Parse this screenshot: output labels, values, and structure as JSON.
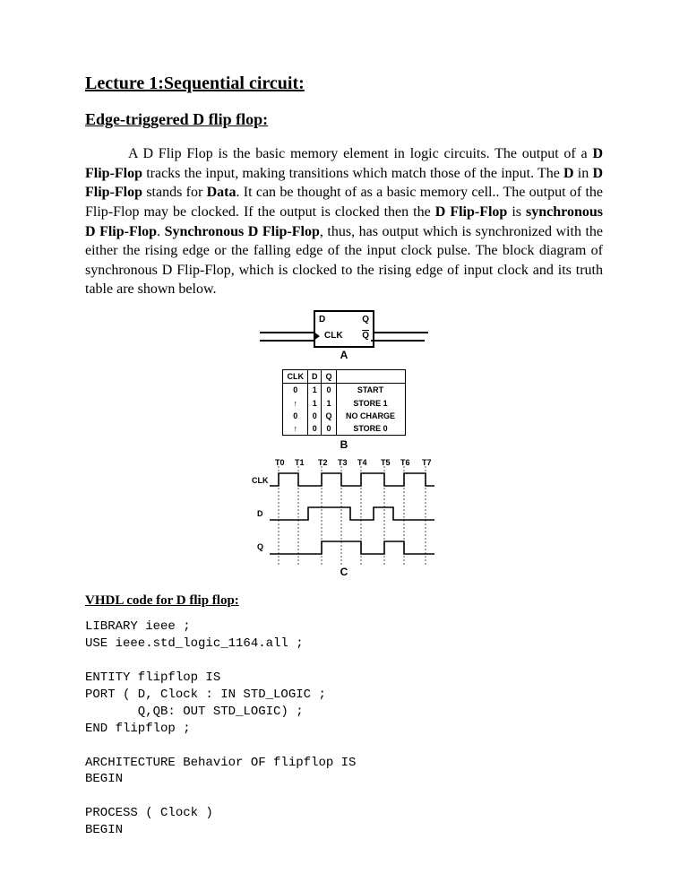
{
  "headings": {
    "lecture": "Lecture 1:Sequential circuit:",
    "subtitle": "Edge-triggered D flip flop:",
    "vhdl": "VHDL code for D flip flop:"
  },
  "paragraph": {
    "p1_a": "A D Flip Flop is the basic memory element in logic circuits. ",
    "p1_b": "The output of a ",
    "p1_c": "D Flip-Flop",
    "p1_d": " tracks the input, making transitions which match those of the input. The ",
    "p1_e": "D",
    "p1_f": " in ",
    "p1_g": "D Flip-Flop",
    "p1_h": " stands for ",
    "p1_i": "Data",
    "p1_j": ". It can be thought of as a basic memory cell.. The output of the Flip-Flop may be clocked. If the output is clocked then the ",
    "p1_k": "D Flip-Flop",
    "p1_l": " is ",
    "p1_m": "synchronous D Flip-Flop",
    "p1_n": ". ",
    "p1_o": "Synchronous D Flip-Flop",
    "p1_p": ", thus, has output which is synchronized with the either the rising edge or the falling edge of the input clock pulse. The block diagram of synchronous D Flip-Flop, which is clocked to the rising edge of input clock and its truth table are shown below."
  },
  "figA": {
    "D": "D",
    "Q": "Q",
    "CLK": "CLK",
    "QB": "Q",
    "label": "A"
  },
  "truth": {
    "head": {
      "c1": "CLK",
      "c2": "D",
      "c3": "Q",
      "c4": ""
    },
    "rows": [
      {
        "c1": "0",
        "c2": "1",
        "c3": "0",
        "c4": "START"
      },
      {
        "c1": "↑",
        "c2": "1",
        "c3": "1",
        "c4": "STORE 1"
      },
      {
        "c1": "0",
        "c2": "0",
        "c3": "Q",
        "c4": "NO CHARGE"
      },
      {
        "c1": "↑",
        "c2": "0",
        "c3": "0",
        "c4": "STORE 0"
      }
    ],
    "label": "B"
  },
  "timing": {
    "ticks": [
      "T0",
      "T1",
      "T2",
      "T3",
      "T4",
      "T5",
      "T6",
      "T7"
    ],
    "rows": [
      "CLK",
      "D",
      "Q"
    ],
    "label": "C"
  },
  "code": {
    "l1": "LIBRARY ieee ;",
    "l2": "USE ieee.std_logic_1164.all ;",
    "l3": "",
    "l4": "ENTITY flipflop IS",
    "l5": "PORT ( D, Clock : IN STD_LOGIC ;",
    "l6": "       Q,QB: OUT STD_LOGIC) ;",
    "l7": "END flipflop ;",
    "l8": "",
    "l9": "ARCHITECTURE Behavior OF flipflop IS",
    "l10": "BEGIN",
    "l11": "",
    "l12": "PROCESS ( Clock )",
    "l13": "BEGIN"
  }
}
